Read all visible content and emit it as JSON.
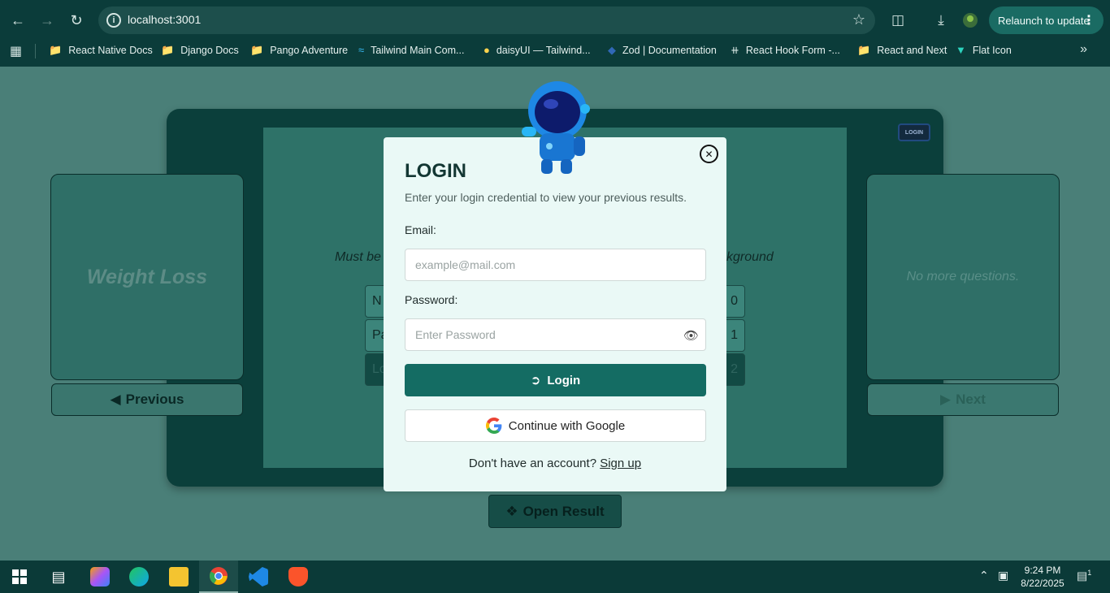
{
  "browser": {
    "url": "localhost:3001",
    "relaunch_label": "Relaunch to update",
    "bookmarks": [
      {
        "label": "React Native Docs",
        "icon": "folder-icon"
      },
      {
        "label": "Django Docs",
        "icon": "folder-icon"
      },
      {
        "label": "Pango Adventure",
        "icon": "folder-icon"
      },
      {
        "label": "Tailwind Main Com...",
        "icon": "tailwind-icon"
      },
      {
        "label": "daisyUI — Tailwind...",
        "icon": "daisyui-icon"
      },
      {
        "label": "Zod | Documentation",
        "icon": "zod-icon"
      },
      {
        "label": "React Hook Form -...",
        "icon": "rhf-icon"
      },
      {
        "label": "React and Next",
        "icon": "folder-icon"
      },
      {
        "label": "Flat Icon",
        "icon": "flaticon-icon"
      }
    ]
  },
  "quiz": {
    "left_card_title": "Weight Loss",
    "right_card_message": "No more questions.",
    "previous_label": "Previous",
    "next_label": "Next",
    "open_result_label": "Open Result",
    "question_left": "Must be",
    "question_right": "kground",
    "options": [
      {
        "prefix": "N",
        "num": "0"
      },
      {
        "prefix": "Pa",
        "num": "1"
      },
      {
        "prefix": "Lo",
        "num": "2"
      }
    ],
    "login_badge": "LOGIN"
  },
  "modal": {
    "title": "LOGIN",
    "subtitle": "Enter your login credential to view your previous results.",
    "email_label": "Email:",
    "email_placeholder": "example@mail.com",
    "password_label": "Password:",
    "password_placeholder": "Enter Password",
    "login_button": "Login",
    "google_button": "Continue with Google",
    "footer_text": "Don't have an account?",
    "signup_link": "Sign up"
  },
  "taskbar": {
    "time": "9:24 PM",
    "date": "8/22/2025",
    "notification_count": "1"
  },
  "colors": {
    "accent": "#146c63",
    "modal_bg": "#eaf9f6",
    "page_bg": "#4a7f78"
  }
}
